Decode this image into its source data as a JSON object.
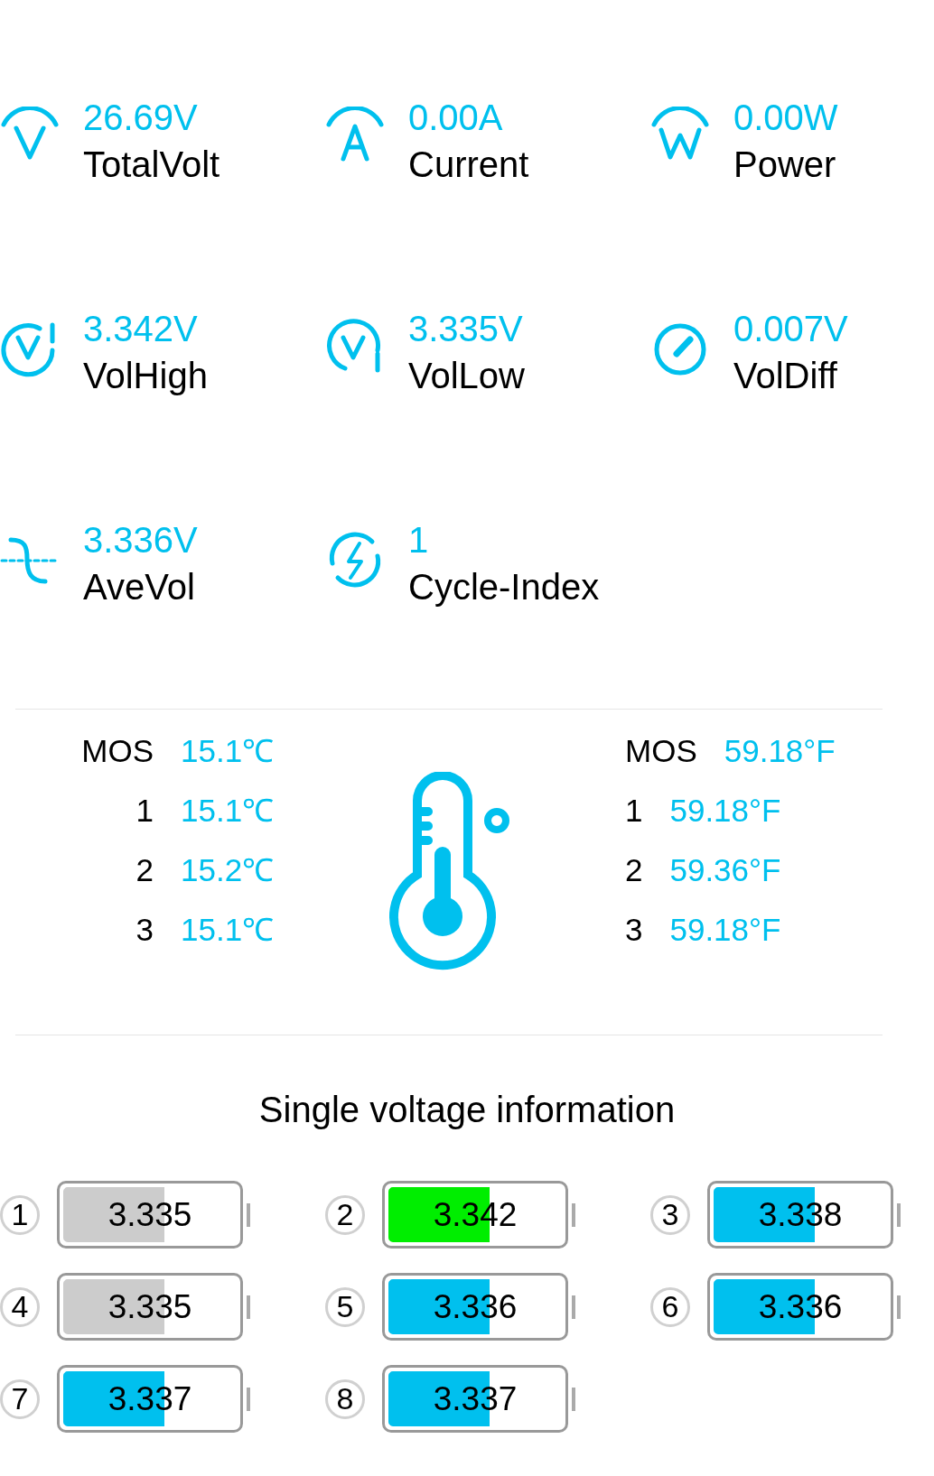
{
  "stats": [
    {
      "kind": "volt",
      "value": "26.69V",
      "label": "TotalVolt"
    },
    {
      "kind": "current",
      "value": "0.00A",
      "label": "Current"
    },
    {
      "kind": "power",
      "value": "0.00W",
      "label": "Power"
    },
    {
      "kind": "high",
      "value": "3.342V",
      "label": "VolHigh"
    },
    {
      "kind": "low",
      "value": "3.335V",
      "label": "VolLow"
    },
    {
      "kind": "diff",
      "value": "0.007V",
      "label": "VolDiff"
    },
    {
      "kind": "ave",
      "value": "3.336V",
      "label": "AveVol"
    },
    {
      "kind": "cycle",
      "value": "1",
      "label": "Cycle-Index"
    }
  ],
  "temps_celsius": [
    {
      "label": "MOS",
      "value": "15.1℃"
    },
    {
      "label": "1",
      "value": "15.1℃"
    },
    {
      "label": "2",
      "value": "15.2℃"
    },
    {
      "label": "3",
      "value": "15.1℃"
    }
  ],
  "temps_fahrenheit": [
    {
      "label": "MOS",
      "value": "59.18°F"
    },
    {
      "label": "1",
      "value": "59.18°F"
    },
    {
      "label": "2",
      "value": "59.36°F"
    },
    {
      "label": "3",
      "value": "59.18°F"
    }
  ],
  "cells_title": "Single voltage information",
  "cells": [
    {
      "index": "1",
      "value": "3.335",
      "level": 0.58,
      "color": "#cccccc"
    },
    {
      "index": "2",
      "value": "3.342",
      "level": 0.58,
      "color": "#00ee00"
    },
    {
      "index": "3",
      "value": "3.338",
      "level": 0.58,
      "color": "#00c0ee"
    },
    {
      "index": "4",
      "value": "3.335",
      "level": 0.58,
      "color": "#cccccc"
    },
    {
      "index": "5",
      "value": "3.336",
      "level": 0.58,
      "color": "#00c0ee"
    },
    {
      "index": "6",
      "value": "3.336",
      "level": 0.58,
      "color": "#00c0ee"
    },
    {
      "index": "7",
      "value": "3.337",
      "level": 0.58,
      "color": "#00c0ee"
    },
    {
      "index": "8",
      "value": "3.337",
      "level": 0.58,
      "color": "#00c0ee"
    }
  ]
}
